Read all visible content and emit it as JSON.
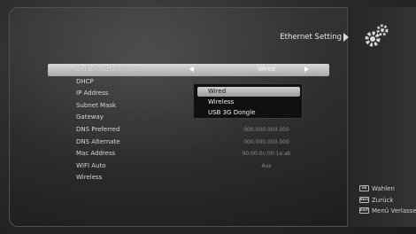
{
  "header": {
    "title": "Ethernet Setting",
    "icon": "gear-icon"
  },
  "settings": [
    {
      "label": "Default Network Type",
      "value": "Wired",
      "selected": true
    },
    {
      "label": "DHCP",
      "value": ""
    },
    {
      "label": "IP Address",
      "value": ""
    },
    {
      "label": "Subnet Mask",
      "value": ""
    },
    {
      "label": "Gateway",
      "value": ""
    },
    {
      "label": "DNS Preferred",
      "value": "000.000.000.000"
    },
    {
      "label": "DNS Alternate",
      "value": "000.000.000.000"
    },
    {
      "label": "Mac Address",
      "value": "00:00:0c:00:1e:ab"
    },
    {
      "label": "WIFI Auto",
      "value": "Aus"
    },
    {
      "label": "Wireless",
      "value": ""
    }
  ],
  "dropdown": {
    "options": [
      "Wired",
      "Wireless",
      "USB 3G Dongle"
    ],
    "selected": "Wired"
  },
  "legend": [
    {
      "key": "OK",
      "label": "Wahlen"
    },
    {
      "key": "BACK",
      "label": "Zurück"
    },
    {
      "key": "EXIT",
      "label": "Menü Verlassen"
    }
  ],
  "colors": {
    "highlight": "#c4c4c4",
    "background": "#2c2c2c"
  }
}
